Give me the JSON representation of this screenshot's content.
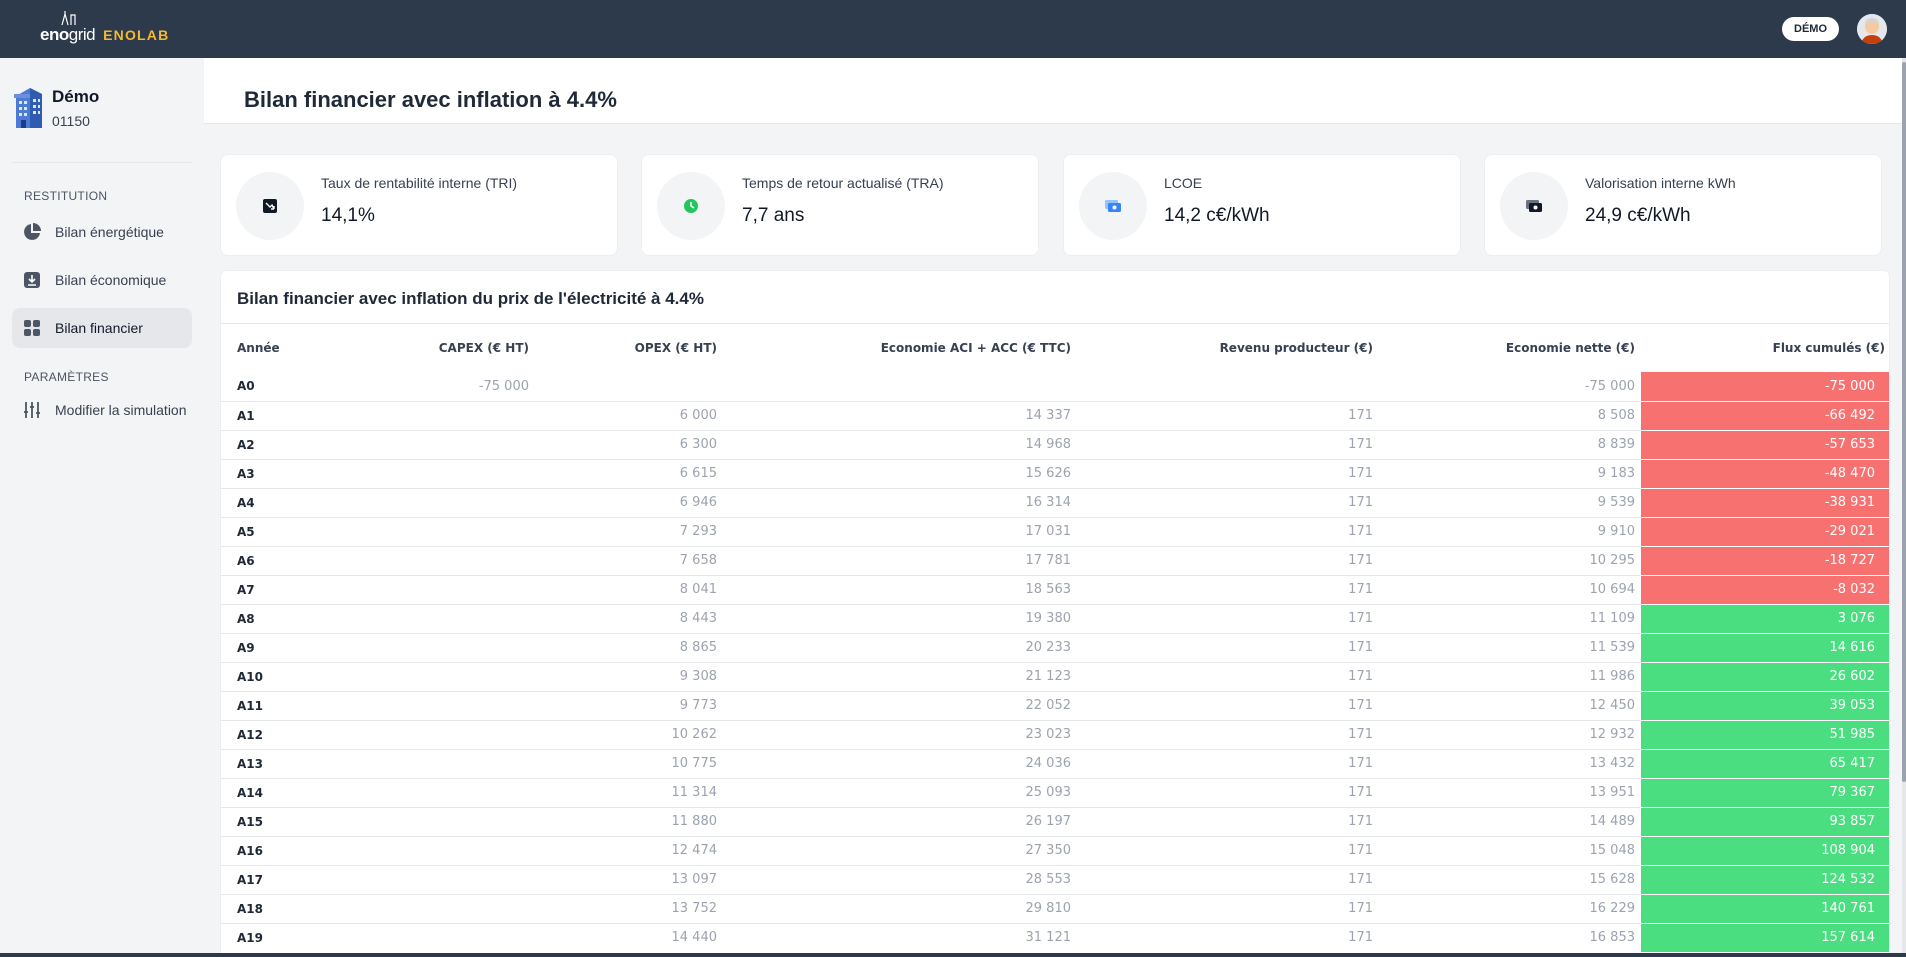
{
  "app": {
    "logo_eno": "eno",
    "logo_grid": "grid",
    "logo_lab": "ENOLAB",
    "user_badge": "DÉMO"
  },
  "project": {
    "name": "Démo",
    "code": "01150"
  },
  "sidebar": {
    "sections": [
      {
        "label": "RESTITUTION"
      },
      {
        "label": "PARAMÈTRES"
      }
    ],
    "items": [
      {
        "label": "Bilan énergétique",
        "icon": "pie-chart-icon"
      },
      {
        "label": "Bilan économique",
        "icon": "download-icon"
      },
      {
        "label": "Bilan financier",
        "icon": "grid-icon",
        "active": true
      },
      {
        "label": "Modifier la simulation",
        "icon": "sliders-icon"
      }
    ]
  },
  "page": {
    "title": "Bilan financier avec inflation à 4.4%"
  },
  "kpis": [
    {
      "label": "Taux de rentabilité interne (TRI)",
      "value": "14,1%",
      "icon": "chart-down-icon"
    },
    {
      "label": "Temps de retour actualisé (TRA)",
      "value": "7,7 ans",
      "icon": "clock-icon",
      "color": "#22c55e"
    },
    {
      "label": "LCOE",
      "value": "14,2 c€/kWh",
      "icon": "cash-icon",
      "color": "#3b82f6"
    },
    {
      "label": "Valorisation interne kWh",
      "value": "24,9 c€/kWh",
      "icon": "wallet-icon"
    }
  ],
  "table": {
    "title": "Bilan financier avec inflation du prix de l'électricité à 4.4%",
    "headers": [
      "Année",
      "CAPEX (€ HT)",
      "OPEX (€ HT)",
      "Economie ACI + ACC (€ TTC)",
      "Revenu producteur (€)",
      "Economie nette (€)",
      "Flux cumulés (€)"
    ],
    "rows": [
      [
        "A0",
        "-75 000",
        "",
        "",
        "",
        "-75 000",
        "-75 000"
      ],
      [
        "A1",
        "",
        "6 000",
        "14 337",
        "171",
        "8 508",
        "-66 492"
      ],
      [
        "A2",
        "",
        "6 300",
        "14 968",
        "171",
        "8 839",
        "-57 653"
      ],
      [
        "A3",
        "",
        "6 615",
        "15 626",
        "171",
        "9 183",
        "-48 470"
      ],
      [
        "A4",
        "",
        "6 946",
        "16 314",
        "171",
        "9 539",
        "-38 931"
      ],
      [
        "A5",
        "",
        "7 293",
        "17 031",
        "171",
        "9 910",
        "-29 021"
      ],
      [
        "A6",
        "",
        "7 658",
        "17 781",
        "171",
        "10 295",
        "-18 727"
      ],
      [
        "A7",
        "",
        "8 041",
        "18 563",
        "171",
        "10 694",
        "-8 032"
      ],
      [
        "A8",
        "",
        "8 443",
        "19 380",
        "171",
        "11 109",
        "3 076"
      ],
      [
        "A9",
        "",
        "8 865",
        "20 233",
        "171",
        "11 539",
        "14 616"
      ],
      [
        "A10",
        "",
        "9 308",
        "21 123",
        "171",
        "11 986",
        "26 602"
      ],
      [
        "A11",
        "",
        "9 773",
        "22 052",
        "171",
        "12 450",
        "39 053"
      ],
      [
        "A12",
        "",
        "10 262",
        "23 023",
        "171",
        "12 932",
        "51 985"
      ],
      [
        "A13",
        "",
        "10 775",
        "24 036",
        "171",
        "13 432",
        "65 417"
      ],
      [
        "A14",
        "",
        "11 314",
        "25 093",
        "171",
        "13 951",
        "79 367"
      ],
      [
        "A15",
        "",
        "11 880",
        "26 197",
        "171",
        "14 489",
        "93 857"
      ],
      [
        "A16",
        "",
        "12 474",
        "27 350",
        "171",
        "15 048",
        "108 904"
      ],
      [
        "A17",
        "",
        "13 097",
        "28 553",
        "171",
        "15 628",
        "124 532"
      ],
      [
        "A18",
        "",
        "13 752",
        "29 810",
        "171",
        "16 229",
        "140 761"
      ],
      [
        "A19",
        "",
        "14 440",
        "31 121",
        "171",
        "16 853",
        "157 614"
      ]
    ],
    "flux_colors": {
      "negative": "#f87171",
      "positive": "#4ade80"
    }
  }
}
